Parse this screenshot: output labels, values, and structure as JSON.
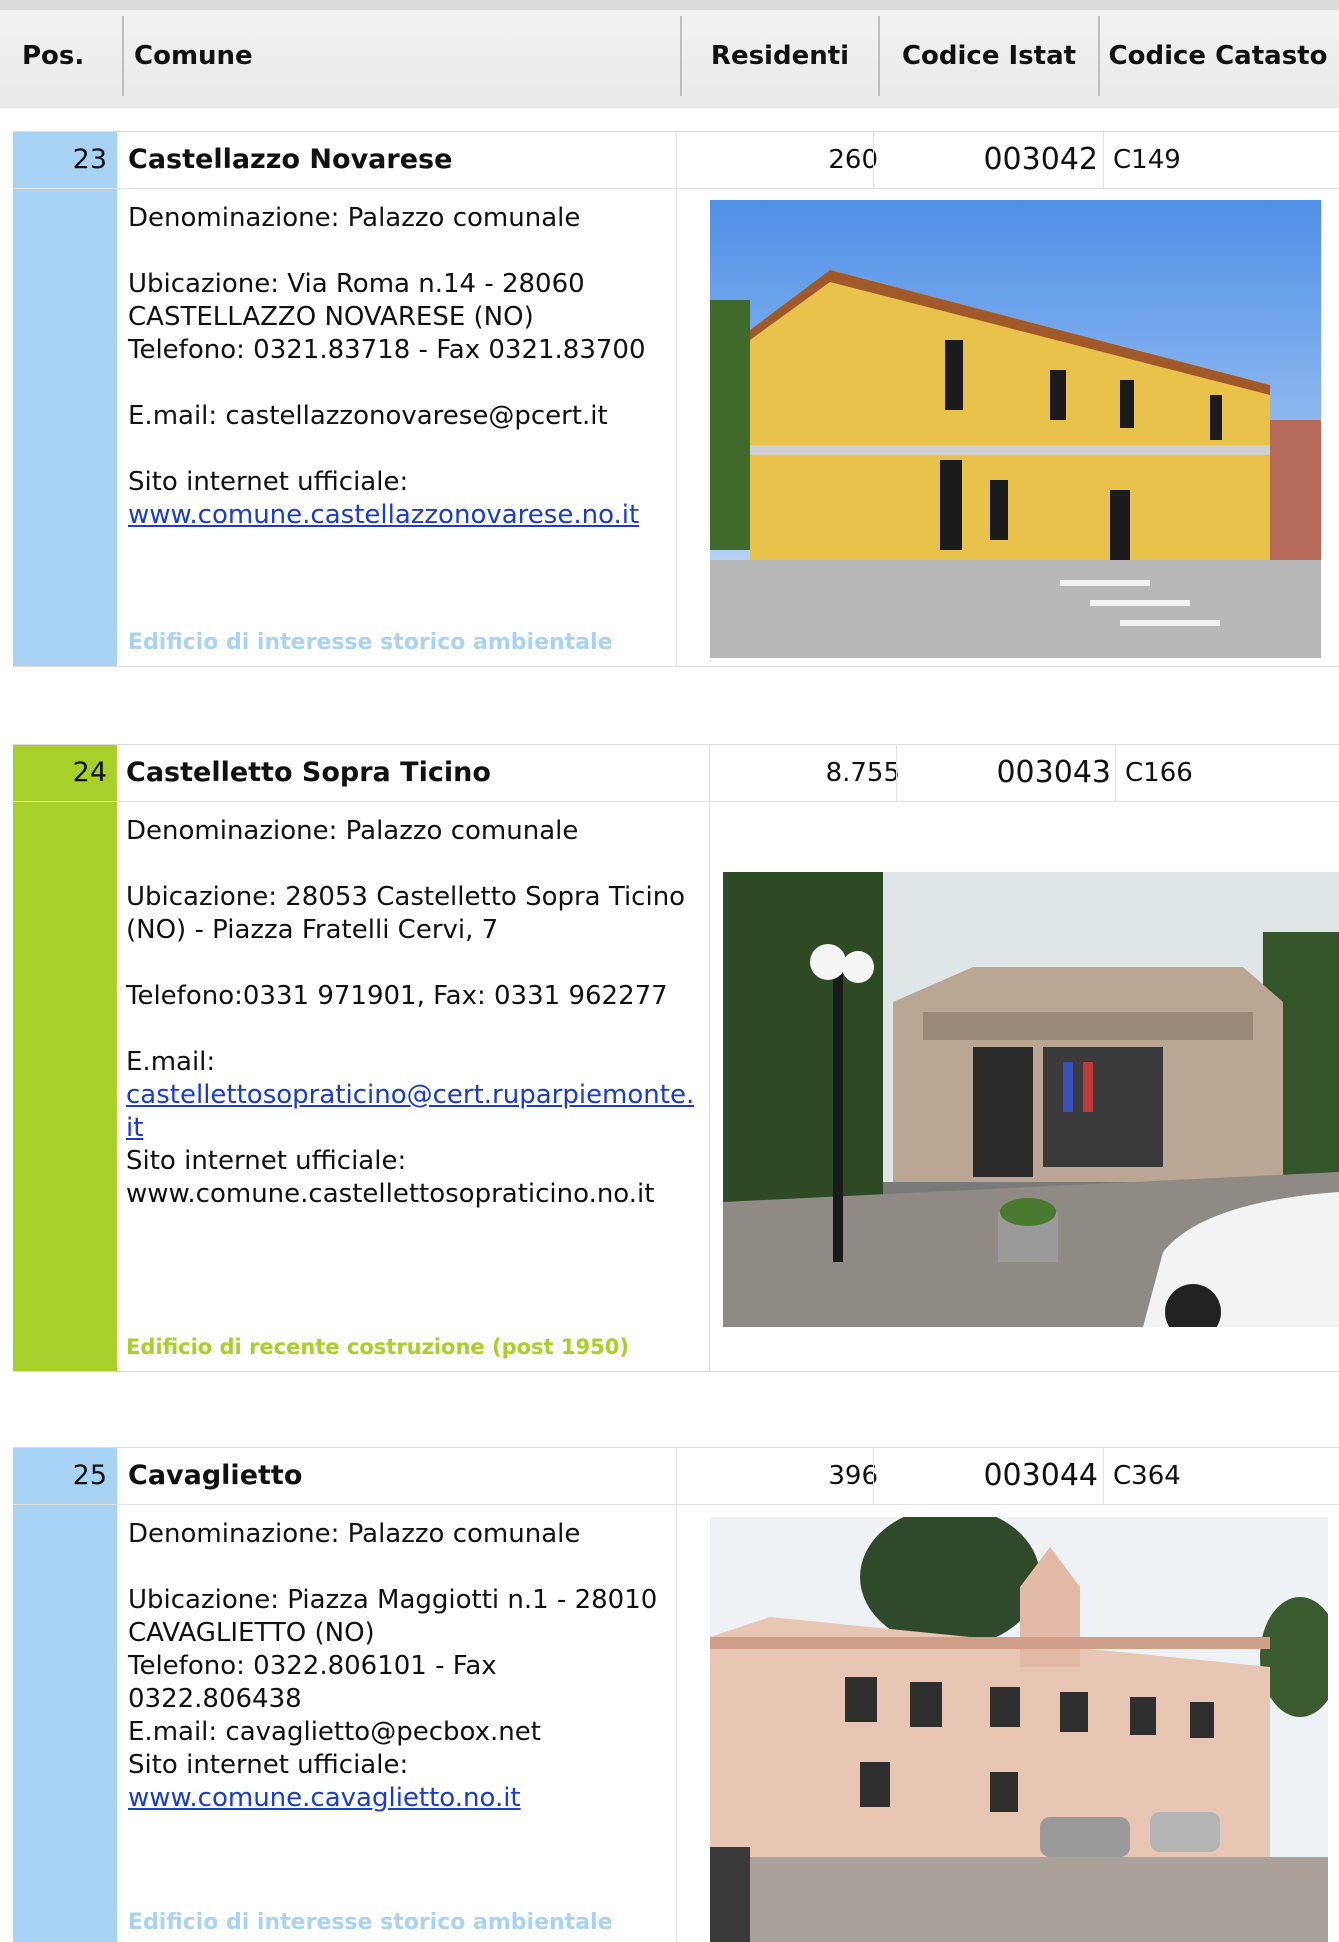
{
  "header": {
    "pos": "Pos.",
    "comune": "Comune",
    "residenti": "Residenti",
    "istat": "Codice Istat",
    "catasto": "Codice Catasto"
  },
  "entries": [
    {
      "pos": "23",
      "name": "Castellazzo Novarese",
      "residents": "260",
      "istat": "003042",
      "catasto": "C149",
      "denominazione": "Denominazione: Palazzo comunale",
      "ubicazione": "Ubicazione: Via Roma n.14 - 28060 CASTELLAZZO NOVARESE (NO)",
      "telefono": "Telefono: 0321.83718 - Fax 0321.83700",
      "email": "E.mail: castellazzonovarese@pcert.it",
      "sito_label": "Sito internet ufficiale:",
      "sito": "www.comune.castellazzonovarese.no.it",
      "tag": "Edificio di interesse storico ambientale",
      "color": "#a9d3f5"
    },
    {
      "pos": "24",
      "name": "Castelletto Sopra Ticino",
      "residents": "8.755",
      "istat": "003043",
      "catasto": "C166",
      "denominazione": "Denominazione: Palazzo comunale",
      "ubicazione": "Ubicazione: 28053 Castelletto Sopra Ticino (NO) - Piazza Fratelli Cervi, 7",
      "telefono": "Telefono:0331 971901, Fax: 0331 962277",
      "email_label": "E.mail:",
      "email": "castellettosopraticino@cert.ruparpiemonte.it",
      "sito_label": "Sito internet ufficiale:",
      "sito": "www.comune.castellettosopraticino.no.it",
      "tag": "Edificio di recente costruzione (post 1950)",
      "color": "#a8cf2a"
    },
    {
      "pos": "25",
      "name": "Cavaglietto",
      "residents": "396",
      "istat": "003044",
      "catasto": "C364",
      "denominazione": "Denominazione: Palazzo comunale",
      "ubicazione": "Ubicazione: Piazza Maggiotti n.1 - 28010 CAVAGLIETTO (NO)",
      "telefono": "Telefono: 0322.806101 - Fax 0322.806438",
      "email": "E.mail: cavaglietto@pecbox.net",
      "sito_label": "Sito internet ufficiale:",
      "sito": "www.comune.cavaglietto.no.it",
      "tag": "Edificio di interesse storico ambientale",
      "color": "#a9d3f5"
    }
  ]
}
